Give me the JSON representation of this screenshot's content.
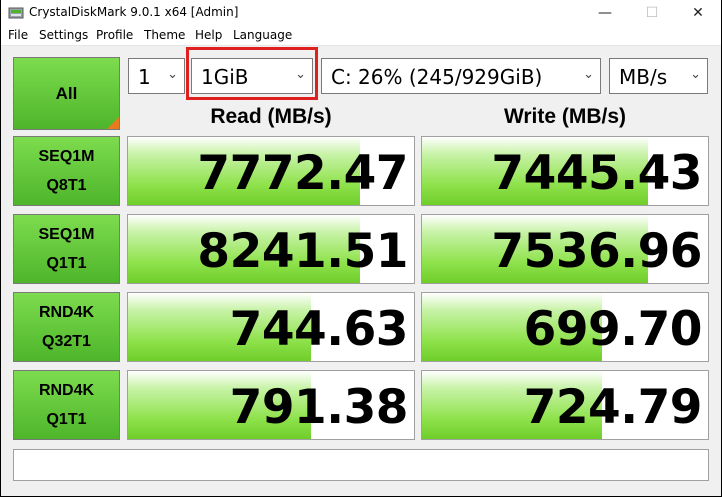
{
  "window": {
    "title": "CrystalDiskMark 9.0.1 x64 [Admin]",
    "controls": {
      "minimize": "—",
      "maximize": "☐",
      "close": "✕"
    }
  },
  "menu": [
    "File",
    "Settings",
    "Profile",
    "Theme",
    "Help",
    "Language"
  ],
  "toolbar": {
    "all_label": "All",
    "count": "1",
    "size": "1GiB",
    "drive": "C: 26% (245/929GiB)",
    "unit": "MB/s"
  },
  "headers": {
    "read": "Read (MB/s)",
    "write": "Write (MB/s)"
  },
  "rows": [
    {
      "line1": "SEQ1M",
      "line2": "Q8T1",
      "read": "7772.47",
      "write": "7445.43",
      "read_fill": 0.81,
      "write_fill": 0.79
    },
    {
      "line1": "SEQ1M",
      "line2": "Q1T1",
      "read": "8241.51",
      "write": "7536.96",
      "read_fill": 0.81,
      "write_fill": 0.79
    },
    {
      "line1": "RND4K",
      "line2": "Q32T1",
      "read": "744.63",
      "write": "699.70",
      "read_fill": 0.64,
      "write_fill": 0.63
    },
    {
      "line1": "RND4K",
      "line2": "Q1T1",
      "read": "791.38",
      "write": "724.79",
      "read_fill": 0.64,
      "write_fill": 0.63
    }
  ],
  "colors": {
    "accent_green": "#4eb52a",
    "highlight_red": "#e0201f",
    "corner_orange": "#e87a1f"
  }
}
